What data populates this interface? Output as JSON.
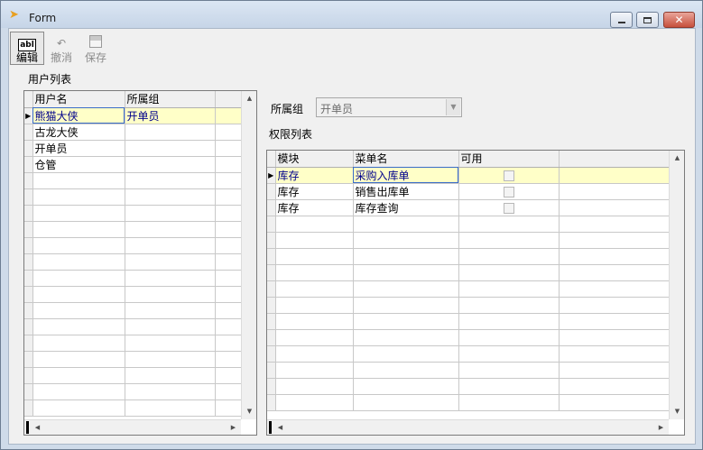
{
  "window": {
    "title": "Form",
    "controls": [
      "minimize",
      "maximize",
      "close"
    ]
  },
  "toolbar": {
    "edit_label": "编辑",
    "edit_icon": "abl",
    "undo_label": "撤消",
    "save_label": "保存"
  },
  "users": {
    "section_label": "用户列表",
    "columns": [
      "用户名",
      "所属组"
    ],
    "rows": [
      [
        "熊猫大侠",
        "开单员"
      ],
      [
        "古龙大侠",
        ""
      ],
      [
        "开单员",
        ""
      ],
      [
        "仓管",
        ""
      ]
    ],
    "selected_row": 0
  },
  "group": {
    "label": "所属组",
    "value": "开单员"
  },
  "permissions": {
    "section_label": "权限列表",
    "columns": [
      "模块",
      "菜单名",
      "可用"
    ],
    "rows": [
      [
        "库存",
        "采购入库单",
        false
      ],
      [
        "库存",
        "销售出库单",
        false
      ],
      [
        "库存",
        "库存查询",
        false
      ]
    ],
    "selected_row": 0
  },
  "colors": {
    "selected_row_bg": "#ffffc8",
    "selected_text": "#00008b",
    "window_frame": "#cfdbe9",
    "close_button": "#c7503c"
  }
}
